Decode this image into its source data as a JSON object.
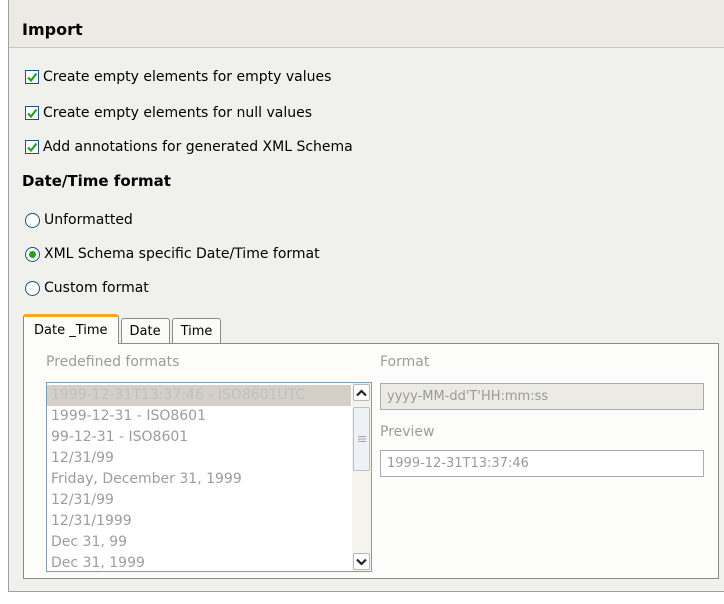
{
  "header": {
    "title": "Import"
  },
  "options": [
    {
      "label": "Create empty elements for empty values",
      "checked": true
    },
    {
      "label": "Create empty elements for null values",
      "checked": true
    },
    {
      "label": "Add annotations for generated XML Schema",
      "checked": true
    }
  ],
  "datetime": {
    "title": "Date/Time format",
    "radios": [
      {
        "label": "Unformatted",
        "selected": false
      },
      {
        "label": "XML Schema specific Date/Time format",
        "selected": true
      },
      {
        "label": "Custom format",
        "selected": false
      }
    ]
  },
  "tabs": [
    {
      "label": "Date _Time",
      "active": true
    },
    {
      "label": "Date",
      "active": false
    },
    {
      "label": "Time",
      "active": false
    }
  ],
  "panel": {
    "predefined_label": "Predefined formats",
    "format_label": "Format",
    "format_value": "yyyy-MM-dd'T'HH:mm:ss",
    "preview_label": "Preview",
    "preview_value": "1999-12-31T13:37:46",
    "formats": [
      "1999-12-31T13:37:46 - ISO8601UTC",
      "1999-12-31 - ISO8601",
      "99-12-31 - ISO8601",
      "12/31/99",
      "Friday, December 31, 1999",
      "12/31/99",
      "12/31/1999",
      "Dec 31, 99",
      "Dec 31, 1999"
    ],
    "selected_index": 0
  },
  "colors": {
    "accent_tab": "#f5a623",
    "check": "#21a121",
    "border_blue": "#1c5180"
  }
}
